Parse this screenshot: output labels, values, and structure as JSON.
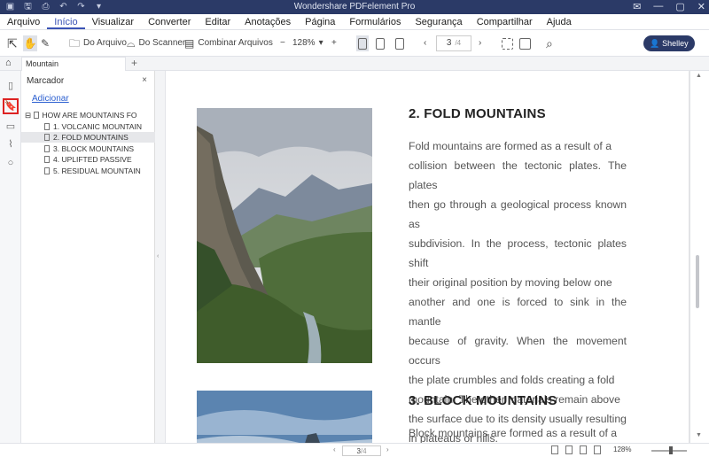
{
  "window": {
    "title": "Wondershare PDFelement Pro"
  },
  "menu": {
    "items": [
      "Arquivo",
      "Início",
      "Visualizar",
      "Converter",
      "Editar",
      "Anotações",
      "Página",
      "Formulários",
      "Segurança",
      "Compartilhar",
      "Ajuda"
    ],
    "active": "Início"
  },
  "toolbar": {
    "do_arquivo": "Do Arquivo",
    "do_scanner": "Do Scanner",
    "combinar": "Combinar Arquivos",
    "zoom_minus": "−",
    "zoom_value": "128%",
    "zoom_plus": "+",
    "page_current": "3",
    "page_total": "/4",
    "user_name": "Shelley"
  },
  "tabs": {
    "document": "Mountain",
    "add": "+"
  },
  "bookmark_panel": {
    "title": "Marcador",
    "close": "×",
    "add_link": "Adicionar",
    "items": [
      {
        "label": "HOW ARE MOUNTAINS FO",
        "level": 0,
        "expander": "⊟"
      },
      {
        "label": "1. VOLCANIC MOUNTAIN",
        "level": 1
      },
      {
        "label": "2. FOLD MOUNTAINS",
        "level": 1,
        "selected": true
      },
      {
        "label": "3. BLOCK MOUNTAINS",
        "level": 1
      },
      {
        "label": "4. UPLIFTED PASSIVE",
        "level": 1
      },
      {
        "label": "5. RESIDUAL MOUNTAIN",
        "level": 1
      }
    ]
  },
  "document": {
    "section1_title": "2. FOLD MOUNTAINS",
    "section1_lines": [
      "Fold mountains are formed as a result of a",
      "collision between the tectonic plates. The plates",
      "then go through a geological process known as",
      "subdivision. In the process, tectonic plates shift",
      "their original position by moving below one",
      "another and one is forced to sink in the mantle",
      "because of gravity. When the movement occurs",
      "the plate crumbles and folds creating a fold",
      "mountain. The other materials remain above",
      "the surface due to its density usually resulting",
      "in plateaus or hills."
    ],
    "section2_title": "3. BLOCK MOUNTAINS",
    "section2_lines": [
      "Block mountains are formed as a result of a"
    ]
  },
  "status": {
    "page_current": "3",
    "page_total": "/4",
    "zoom": "128%"
  },
  "colors": {
    "accent": "#2b3a67",
    "link": "#2b5fd0",
    "highlight": "#d22222"
  }
}
